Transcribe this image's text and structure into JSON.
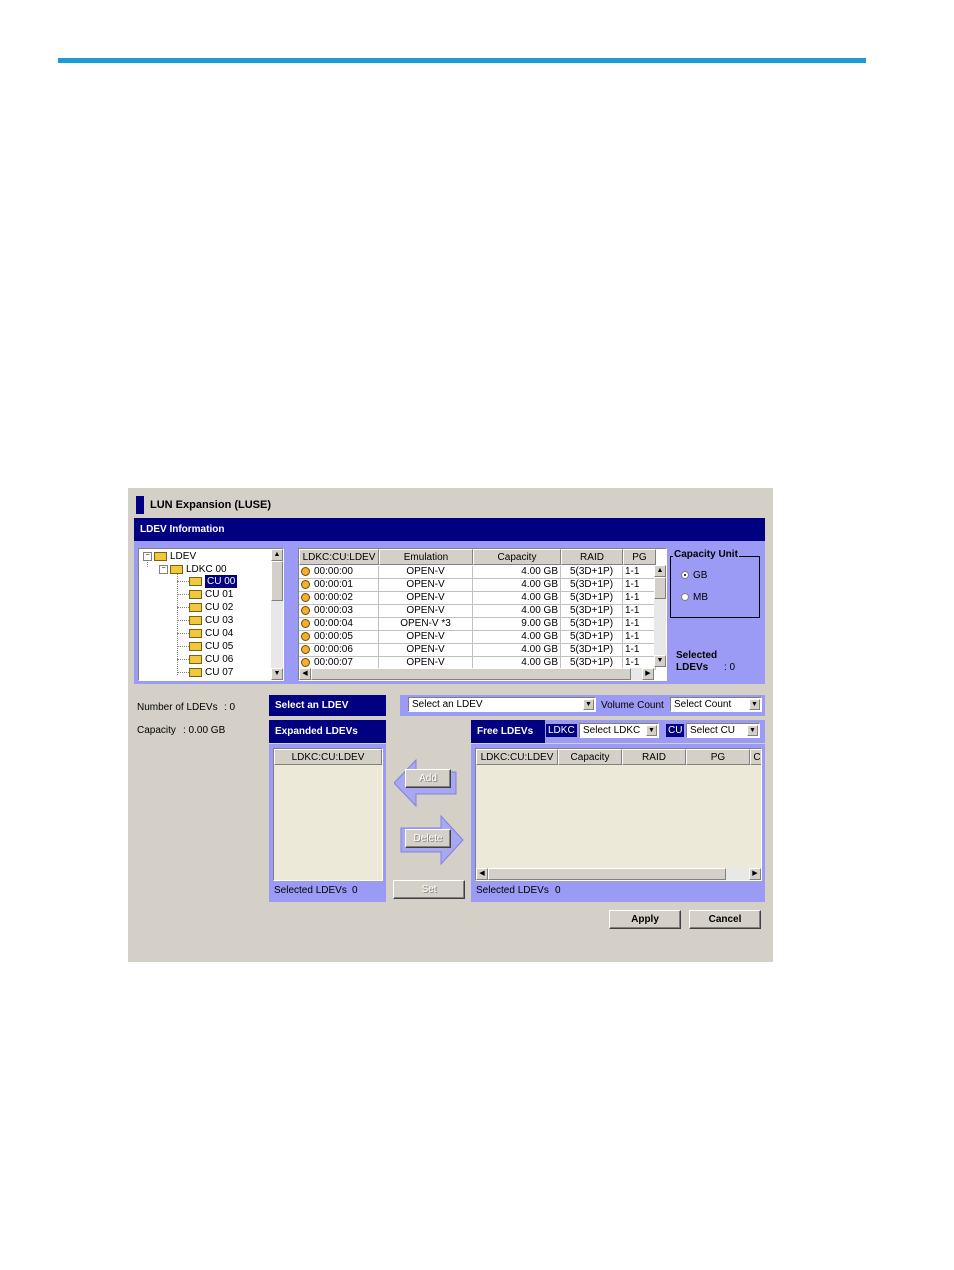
{
  "window": {
    "title": "LUN Expansion (LUSE)"
  },
  "ldev_info": {
    "header": "LDEV Information",
    "tree": {
      "root": "LDEV",
      "ldkc": "LDKC 00",
      "cus": [
        "CU 00",
        "CU 01",
        "CU 02",
        "CU 03",
        "CU 04",
        "CU 05",
        "CU 06",
        "CU 07"
      ],
      "selected": "CU 00"
    },
    "table": {
      "columns": [
        "LDKC:CU:LDEV",
        "Emulation",
        "Capacity",
        "RAID",
        "PG"
      ],
      "rows": [
        [
          "00:00:00",
          "OPEN-V",
          "4.00 GB",
          "5(3D+1P)",
          "1-1"
        ],
        [
          "00:00:01",
          "OPEN-V",
          "4.00 GB",
          "5(3D+1P)",
          "1-1"
        ],
        [
          "00:00:02",
          "OPEN-V",
          "4.00 GB",
          "5(3D+1P)",
          "1-1"
        ],
        [
          "00:00:03",
          "OPEN-V",
          "4.00 GB",
          "5(3D+1P)",
          "1-1"
        ],
        [
          "00:00:04",
          "OPEN-V *3",
          "9.00 GB",
          "5(3D+1P)",
          "1-1"
        ],
        [
          "00:00:05",
          "OPEN-V",
          "4.00 GB",
          "5(3D+1P)",
          "1-1"
        ],
        [
          "00:00:06",
          "OPEN-V",
          "4.00 GB",
          "5(3D+1P)",
          "1-1"
        ],
        [
          "00:00:07",
          "OPEN-V",
          "4.00 GB",
          "5(3D+1P)",
          "1-1"
        ]
      ]
    },
    "capacity_unit": {
      "label": "Capacity Unit",
      "options": [
        "GB",
        "MB"
      ],
      "selected": "GB"
    },
    "selected_ldevs": {
      "label_line1": "Selected",
      "label_line2": "LDEVs",
      "value": ": 0"
    }
  },
  "summary": {
    "number_label": "Number of LDEVs",
    "number_value": ": 0",
    "capacity_label": "Capacity",
    "capacity_value": ": 0.00 GB"
  },
  "select_ldev": {
    "label": "Select an LDEV",
    "combo_value": "Select an LDEV",
    "volume_count_label": "Volume Count",
    "volume_count_value": "Select Count"
  },
  "expanded": {
    "header": "Expanded LDEVs",
    "column": "LDKC:CU:LDEV",
    "selected_label": "Selected LDEVs",
    "selected_value": "0"
  },
  "actions": {
    "add": "Add",
    "delete": "Delete",
    "set": "Set"
  },
  "free": {
    "header": "Free LDEVs",
    "ldkc_label": "LDKC",
    "ldkc_value": "Select LDKC",
    "cu_label": "CU",
    "cu_value": "Select CU",
    "columns": [
      "LDKC:CU:LDEV",
      "Capacity",
      "RAID",
      "PG",
      "C"
    ],
    "selected_label": "Selected LDEVs",
    "selected_value": "0"
  },
  "footer": {
    "apply": "Apply",
    "cancel": "Cancel"
  },
  "colors": {
    "accent_line": "#1a9ad6",
    "header_bar": "#000080",
    "panel_blue": "#9b9bf5",
    "panel_gray": "#d4d0c8"
  }
}
